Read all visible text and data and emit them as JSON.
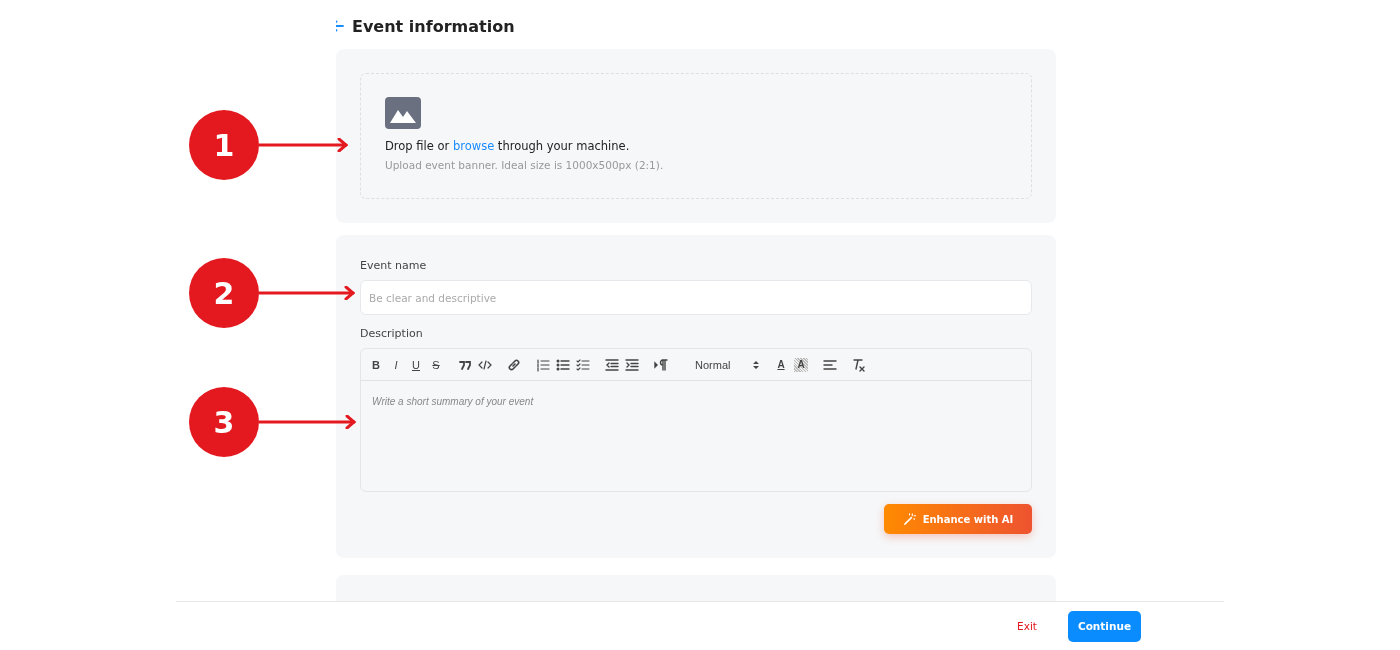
{
  "header": {
    "title": "Event information"
  },
  "upload": {
    "before": "Drop file or ",
    "link": "browse",
    "after": " through your machine.",
    "hint": "Upload event banner. Ideal size is 1000x500px (2:1)."
  },
  "event_name": {
    "label": "Event name",
    "placeholder": "Be clear and descriptive"
  },
  "description": {
    "label": "Description",
    "placeholder": "Write a short summary of your event",
    "toolbar": [
      [
        {
          "kind": "bold",
          "label": "B"
        },
        {
          "kind": "italic",
          "label": "I"
        },
        {
          "kind": "underline",
          "label": "U"
        },
        {
          "kind": "strike",
          "label": "S"
        }
      ],
      [
        {
          "kind": "quote"
        },
        {
          "kind": "code"
        }
      ],
      [
        {
          "kind": "link"
        }
      ],
      [
        {
          "kind": "ordered"
        },
        {
          "kind": "bullet"
        },
        {
          "kind": "check"
        }
      ],
      [
        {
          "kind": "outdent"
        },
        {
          "kind": "indent"
        }
      ],
      [
        {
          "kind": "direction"
        }
      ],
      [
        {
          "kind": "select",
          "label": "Normal"
        }
      ],
      [
        {
          "kind": "color",
          "label": "A"
        },
        {
          "kind": "background",
          "label": "A"
        }
      ],
      [
        {
          "kind": "align"
        }
      ],
      [
        {
          "kind": "clean"
        }
      ]
    ]
  },
  "enhance_button": "Enhance with AI",
  "footer": {
    "exit": "Exit",
    "continue": "Continue"
  },
  "callouts": [
    {
      "number": "1"
    },
    {
      "number": "2"
    },
    {
      "number": "3"
    }
  ]
}
